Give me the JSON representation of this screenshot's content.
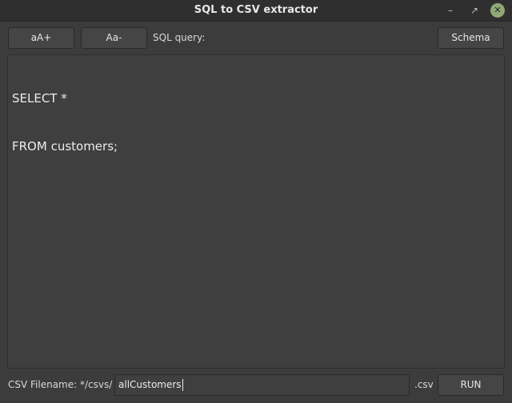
{
  "window": {
    "title": "SQL to CSV extractor",
    "controls": {
      "minimize": "–",
      "maximize": "↗",
      "close": "✕"
    }
  },
  "toolbar": {
    "increase_font_label": "aA+",
    "decrease_font_label": "Aa-",
    "query_label": "SQL query:",
    "schema_label": "Schema"
  },
  "editor": {
    "lines": [
      "SELECT *",
      "FROM customers;"
    ]
  },
  "footer": {
    "filename_label": "CSV Filename: */csvs/",
    "filename_value": "allCustomers",
    "extension_label": ".csv",
    "run_label": "RUN"
  }
}
